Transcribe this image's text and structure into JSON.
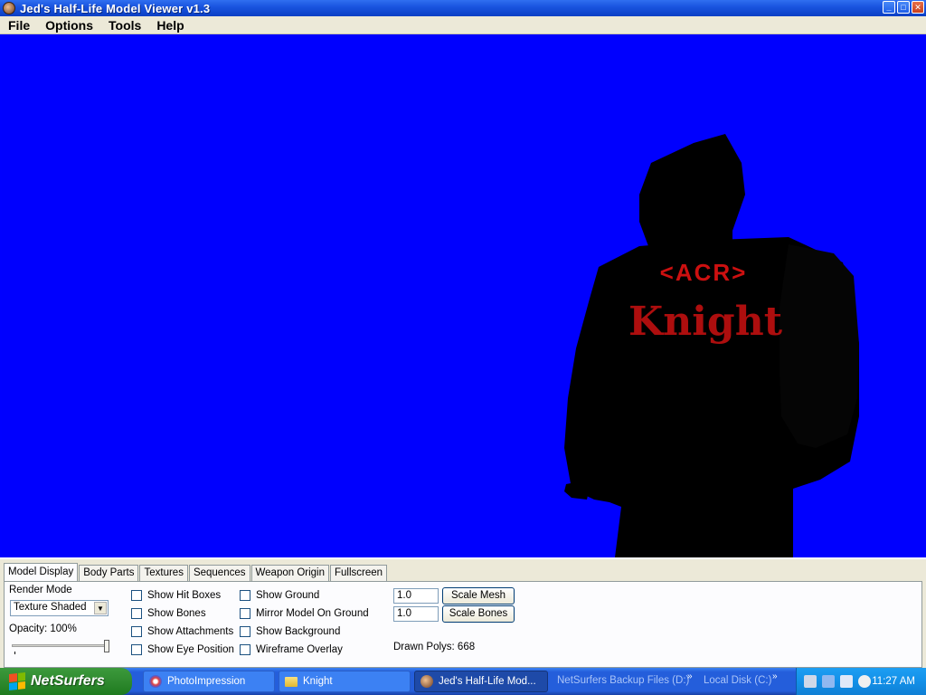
{
  "window": {
    "title": "Jed's Half-Life Model Viewer v1.3",
    "buttons": {
      "minimize": "_",
      "maximize": "□",
      "close": "✕"
    }
  },
  "menu": [
    "File",
    "Options",
    "Tools",
    "Help"
  ],
  "viewport": {
    "background_color": "#0000fe",
    "model": {
      "text_top": "<ACR>",
      "text_bottom": "Knight",
      "text_color": "#cc1010"
    }
  },
  "tabs": [
    "Model Display",
    "Body Parts",
    "Textures",
    "Sequences",
    "Weapon Origin",
    "Fullscreen"
  ],
  "model_display": {
    "render_mode_label": "Render Mode",
    "render_mode_value": "Texture Shaded",
    "opacity_label": "Opacity: 100%",
    "opacity_value": 1.0,
    "checks_col1": [
      "Show Hit Boxes",
      "Show Bones",
      "Show Attachments",
      "Show Eye Position"
    ],
    "checks_col2": [
      "Show Ground",
      "Mirror Model On Ground",
      "Show Background",
      "Wireframe Overlay"
    ],
    "scale_mesh_value": "1.0",
    "scale_mesh_button": "Scale Mesh",
    "scale_bones_value": "1.0",
    "scale_bones_button": "Scale Bones",
    "drawn_polys": "Drawn Polys: 668"
  },
  "taskbar": {
    "start_label": "NetSurfers",
    "tasks": [
      {
        "label": "PhotoImpression",
        "icon": "photoimpression-icon",
        "active": false
      },
      {
        "label": "Knight",
        "icon": "folder-icon",
        "active": false
      },
      {
        "label": "Jed's Half-Life Mod...",
        "icon": "hlmv-icon",
        "active": true
      }
    ],
    "toolbars": [
      "NetSurfers Backup Files (D:)",
      "Local Disk (C:)"
    ],
    "clock": "11:27 AM"
  }
}
